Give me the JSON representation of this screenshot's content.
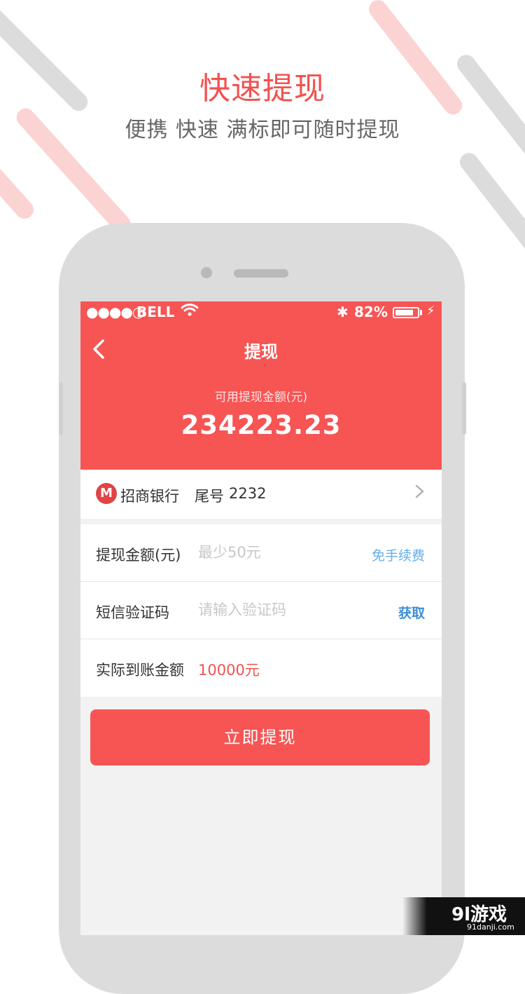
{
  "promo": {
    "title": "快速提现",
    "subtitle": "便携 快速 满标即可随时提现"
  },
  "status_bar": {
    "signal": "●●●●○",
    "carrier": "BELL",
    "battery_percent": "82%",
    "battery_level": 0.82
  },
  "nav": {
    "back_icon": "chevron-left-icon",
    "title": "提现"
  },
  "balance": {
    "label": "可用提现金额(元)",
    "amount": "234223.23"
  },
  "bank": {
    "logo_letter": "M",
    "name": "招商银行",
    "tail_label": "尾号",
    "tail_number": "2232"
  },
  "form": {
    "amount_label": "提现金额(元)",
    "amount_placeholder": "最少50元",
    "fee_note": "免手续费",
    "sms_label": "短信验证码",
    "sms_placeholder": "请输入验证码",
    "get_code": "获取",
    "actual_label": "实际到账金额",
    "actual_value": "10000元"
  },
  "submit_label": "立即提现",
  "watermark": {
    "main": "9l游戏",
    "sub": "91danji.com"
  },
  "colors": {
    "accent": "#f75454",
    "link": "#65aee8",
    "background": "#f2f2f2"
  }
}
